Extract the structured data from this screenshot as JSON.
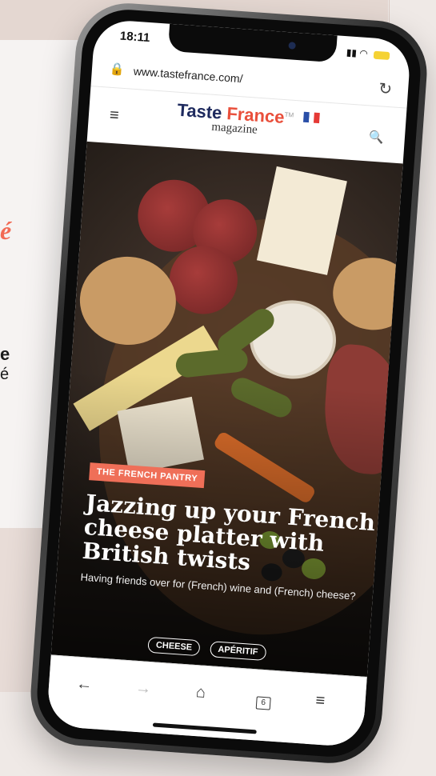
{
  "background": {
    "accent_text": "é",
    "bold_text": "e",
    "text": "é"
  },
  "status_bar": {
    "time": "18:11",
    "icons": "▮▮ ◠"
  },
  "browser": {
    "url": "www.tastefrance.com/",
    "lock_icon": "🔒",
    "reload_icon": "↻",
    "toolbar": {
      "back_icon": "←",
      "forward_icon": "→",
      "home_icon": "⌂",
      "tabs_count": "6",
      "menu_icon": "≡"
    }
  },
  "site": {
    "logo_line1_a": "Taste",
    "logo_line1_b": "France",
    "logo_tm": "TM",
    "logo_line2": "magazine",
    "menu_icon": "≡",
    "search_icon": "🔍",
    "flag_colors": [
      "#2a4fa7",
      "#ffffff",
      "#e53935"
    ]
  },
  "article": {
    "category": "THE FRENCH PANTRY",
    "title": "Jazzing up your French cheese platter with British twists",
    "excerpt": "Having friends over for (French) wine and (French) cheese?",
    "tags": [
      "CHEESE",
      "APÉRITIF"
    ]
  },
  "colors": {
    "brand_navy": "#1e2a5e",
    "brand_red": "#e94f3b",
    "tag_coral": "#ef6f58"
  }
}
